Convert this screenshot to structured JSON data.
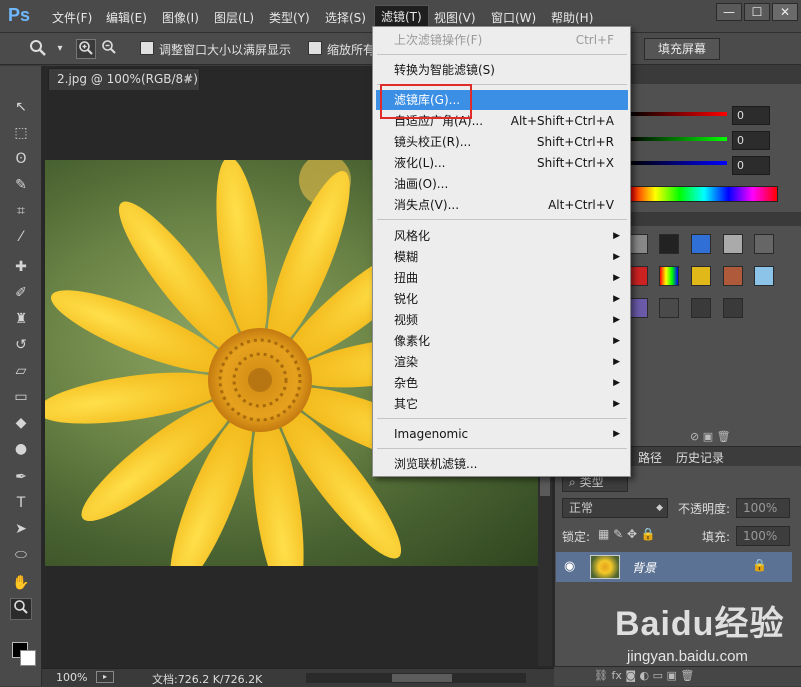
{
  "app": {
    "logo": "Ps",
    "menus": [
      "文件(F)",
      "编辑(E)",
      "图像(I)",
      "图层(L)",
      "类型(Y)",
      "选择(S)",
      "滤镜(T)",
      "视图(V)",
      "窗口(W)",
      "帮助(H)"
    ],
    "active_menu": "滤镜(T)",
    "window_buttons": [
      "—",
      "☐",
      "✕"
    ]
  },
  "options_bar": {
    "resize_window_label": "调整窗口大小以满屏显示",
    "zoom_all_label": "缩放所有",
    "fill_screen_button": "填充屏幕"
  },
  "document": {
    "tab_title": "2.jpg @ 100%(RGB/8#)",
    "close_glyph": "×",
    "zoom": "100%",
    "doc_info": "文档:726.2 K/726.2K"
  },
  "filter_menu": {
    "items": [
      {
        "label": "上次滤镜操作(F)",
        "shortcut": "Ctrl+F",
        "disabled": true
      },
      {
        "label": "转换为智能滤镜(S)",
        "shortcut": ""
      },
      {
        "label": "滤镜库(G)...",
        "shortcut": "",
        "highlighted": true
      },
      {
        "label": "自适应广角(A)...",
        "shortcut": "Alt+Shift+Ctrl+A"
      },
      {
        "label": "镜头校正(R)...",
        "shortcut": "Shift+Ctrl+R"
      },
      {
        "label": "液化(L)...",
        "shortcut": "Shift+Ctrl+X"
      },
      {
        "label": "油画(O)...",
        "shortcut": ""
      },
      {
        "label": "消失点(V)...",
        "shortcut": "Alt+Ctrl+V"
      },
      {
        "label": "风格化",
        "submenu": true
      },
      {
        "label": "模糊",
        "submenu": true
      },
      {
        "label": "扭曲",
        "submenu": true
      },
      {
        "label": "锐化",
        "submenu": true
      },
      {
        "label": "视频",
        "submenu": true
      },
      {
        "label": "像素化",
        "submenu": true
      },
      {
        "label": "渲染",
        "submenu": true
      },
      {
        "label": "杂色",
        "submenu": true
      },
      {
        "label": "其它",
        "submenu": true
      },
      {
        "label": "Imagenomic",
        "submenu": true
      },
      {
        "label": "浏览联机滤镜..."
      }
    ],
    "submenu_arrow": "▶"
  },
  "color_panel": {
    "values": [
      "0",
      "0",
      "0"
    ]
  },
  "layers_panel": {
    "tabs": [
      "路径",
      "历史记录"
    ],
    "filter_kind": "类型",
    "blend_mode": "正常",
    "opacity_label": "不透明度:",
    "opacity_value": "100%",
    "lock_label": "锁定:",
    "fill_label": "填充:",
    "fill_value": "100%",
    "layer_name": "背景"
  },
  "watermark": {
    "text": "Baidu经验",
    "url": "jingyan.baidu.com"
  },
  "colors": {
    "highlight": "#3b8fe4",
    "annotation": "#e02b2b",
    "menu_bg": "#ededed",
    "ui_dark": "#4a4a4a"
  }
}
